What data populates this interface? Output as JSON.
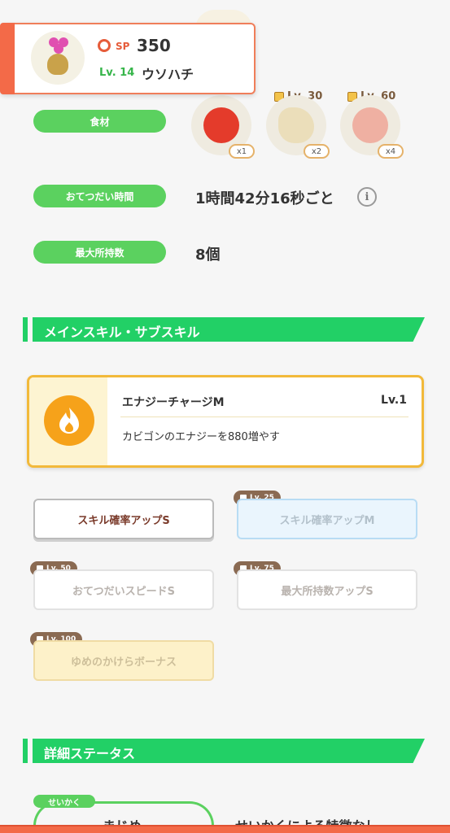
{
  "pokemon": {
    "sp_label": "SP",
    "sp_value": "350",
    "level_label": "Lv. 14",
    "name": "ウソハチ"
  },
  "stats": {
    "ingredients_label": "食材",
    "help_time_label": "おてつだい時間",
    "help_time_value": "1時間42分16秒ごと",
    "max_carry_label": "最大所持数",
    "max_carry_value": "8個"
  },
  "ingredients": [
    {
      "name": "tomato",
      "qty": "x1",
      "unlock": ""
    },
    {
      "name": "soybeans",
      "qty": "x2",
      "unlock": "Lv. 30"
    },
    {
      "name": "tomato",
      "qty": "x4",
      "unlock": "Lv. 60"
    }
  ],
  "sections": {
    "skills_title": "メインスキル・サブスキル",
    "details_title": "詳細ステータス"
  },
  "main_skill": {
    "name": "エナジーチャージM",
    "level": "Lv.1",
    "description": "カビゴンのエナジーを880増やす",
    "icon": "flame-icon"
  },
  "sub_skills": [
    {
      "label": "スキル確率アップS",
      "unlock": "",
      "state": "active"
    },
    {
      "label": "スキル確率アップM",
      "unlock": "Lv. 25",
      "state": "blue"
    },
    {
      "label": "おてつだいスピードS",
      "unlock": "Lv. 50",
      "state": "plain"
    },
    {
      "label": "最大所持数アップS",
      "unlock": "Lv. 75",
      "state": "plain"
    },
    {
      "label": "ゆめのかけらボーナス",
      "unlock": "Lv. 100",
      "state": "gold"
    }
  ],
  "nature": {
    "tag": "せいかく",
    "value": "まじめ",
    "effect": "せいかくによる特徴なし"
  },
  "colors": {
    "accent_green": "#22d066",
    "pill_green": "#5bd15f",
    "header_orange": "#f36a48",
    "skill_gold": "#f2b93a"
  }
}
